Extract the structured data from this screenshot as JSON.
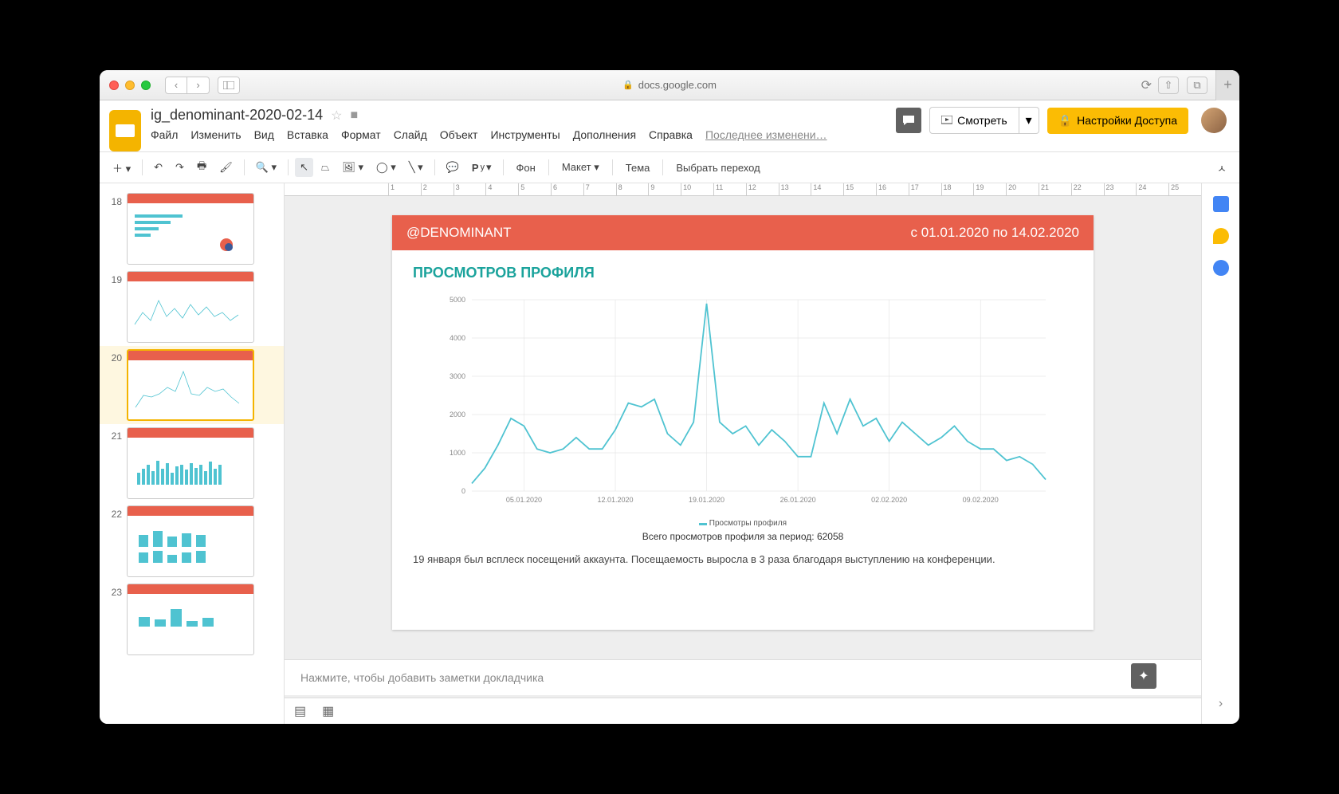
{
  "browser": {
    "url": "docs.google.com"
  },
  "doc": {
    "title": "ig_denominant-2020-02-14",
    "menus": [
      "Файл",
      "Изменить",
      "Вид",
      "Вставка",
      "Формат",
      "Слайд",
      "Объект",
      "Инструменты",
      "Дополнения",
      "Справка"
    ],
    "last_edit": "Последнее изменени…",
    "present": "Смотреть",
    "share": "Настройки Доступа"
  },
  "toolbar": {
    "background": "Фон",
    "layout": "Макет",
    "theme": "Тема",
    "transition": "Выбрать переход"
  },
  "thumbs": [
    {
      "num": "18"
    },
    {
      "num": "19"
    },
    {
      "num": "20"
    },
    {
      "num": "21"
    },
    {
      "num": "22"
    },
    {
      "num": "23"
    }
  ],
  "slide": {
    "account": "@DENOMINANT",
    "date_range": "с 01.01.2020 по 14.02.2020",
    "section_title": "ПРОСМОТРОВ ПРОФИЛЯ",
    "legend": "Просмотры профиля",
    "caption": "Всего просмотров профиля за период: 62058",
    "note": "19 января был всплеск посещений аккаунта. Посещаемость выросла в 3 раза благодаря выступлению на конференции."
  },
  "speaker_notes_placeholder": "Нажмите, чтобы добавить заметки докладчика",
  "chart_data": {
    "type": "line",
    "xlabel": "",
    "ylabel": "",
    "ylim": [
      0,
      5000
    ],
    "x_tick_labels": [
      "05.01.2020",
      "12.01.2020",
      "19.01.2020",
      "26.01.2020",
      "02.02.2020",
      "09.02.2020"
    ],
    "y_tick_labels": [
      "0",
      "1000",
      "2000",
      "3000",
      "4000",
      "5000"
    ],
    "x": [
      "01.01.2020",
      "02.01.2020",
      "03.01.2020",
      "04.01.2020",
      "05.01.2020",
      "06.01.2020",
      "07.01.2020",
      "08.01.2020",
      "09.01.2020",
      "10.01.2020",
      "11.01.2020",
      "12.01.2020",
      "13.01.2020",
      "14.01.2020",
      "15.01.2020",
      "16.01.2020",
      "17.01.2020",
      "18.01.2020",
      "19.01.2020",
      "20.01.2020",
      "21.01.2020",
      "22.01.2020",
      "23.01.2020",
      "24.01.2020",
      "25.01.2020",
      "26.01.2020",
      "27.01.2020",
      "28.01.2020",
      "29.01.2020",
      "30.01.2020",
      "31.01.2020",
      "01.02.2020",
      "02.02.2020",
      "03.02.2020",
      "04.02.2020",
      "05.02.2020",
      "06.02.2020",
      "07.02.2020",
      "08.02.2020",
      "09.02.2020",
      "10.02.2020",
      "11.02.2020",
      "12.02.2020",
      "13.02.2020",
      "14.02.2020"
    ],
    "series": [
      {
        "name": "Просмотры профиля",
        "values": [
          200,
          600,
          1200,
          1900,
          1700,
          1100,
          1000,
          1100,
          1400,
          1100,
          1100,
          1600,
          2300,
          2200,
          2400,
          1500,
          1200,
          1800,
          4900,
          1800,
          1500,
          1700,
          1200,
          1600,
          1300,
          900,
          900,
          2300,
          1500,
          2400,
          1700,
          1900,
          1300,
          1800,
          1500,
          1200,
          1400,
          1700,
          1300,
          1100,
          1100,
          800,
          900,
          700,
          300
        ]
      }
    ]
  }
}
